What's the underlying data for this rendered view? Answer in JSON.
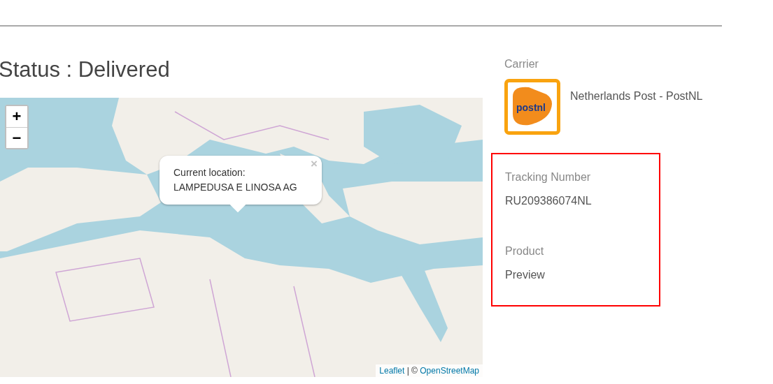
{
  "status_title": "Status : Delivered",
  "map": {
    "zoom_in": "+",
    "zoom_out": "−",
    "popup": {
      "lines": [
        "Current location:",
        "LAMPEDUSA E LINOSA AG"
      ],
      "close": "×"
    },
    "attribution": {
      "link": "Leaflet",
      "separator": " | © ",
      "source": "OpenStreetMap"
    }
  },
  "carrier": {
    "label": "Carrier",
    "logo_text": "postnl",
    "name": "Netherlands Post - PostNL"
  },
  "details": [
    {
      "label": "Tracking Number",
      "value": "RU209386074NL"
    },
    {
      "label": "Product",
      "value": "Preview"
    }
  ]
}
